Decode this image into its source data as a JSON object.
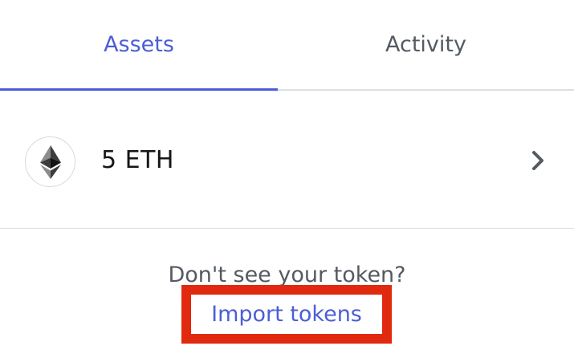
{
  "tabs": [
    {
      "label": "Assets",
      "active": true
    },
    {
      "label": "Activity",
      "active": false
    }
  ],
  "asset": {
    "icon": "ethereum-icon",
    "amount": "5 ETH",
    "chevron_icon": "chevron-right-icon"
  },
  "import_section": {
    "prompt": "Don't see your token?",
    "link_label": "Import tokens"
  },
  "colors": {
    "accent": "#4b5ed6",
    "highlight_box": "#e0290f",
    "muted_text": "#535a61"
  }
}
